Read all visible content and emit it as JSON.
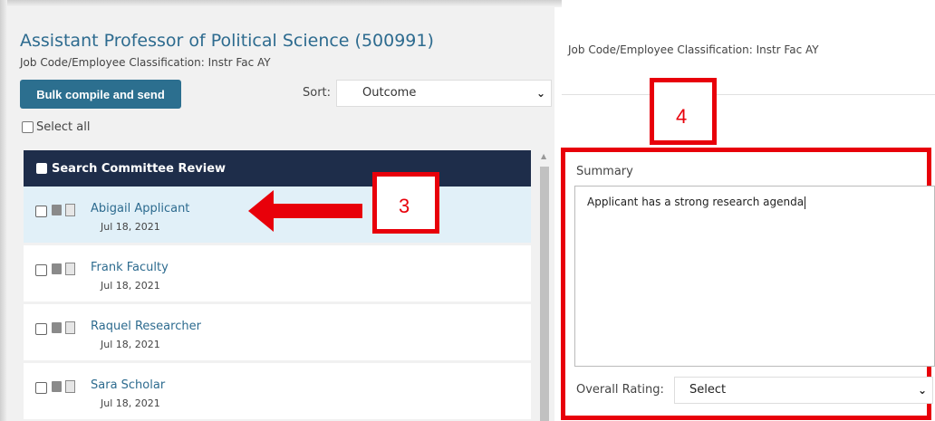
{
  "posting": {
    "title": "Assistant Professor of Political Science (500991)",
    "job_code_line": "Job Code/Employee Classification: Instr Fac AY"
  },
  "toolbar": {
    "bulk_label": "Bulk compile and send",
    "sort_label": "Sort:",
    "sort_value": "Outcome",
    "select_all_label": "Select all"
  },
  "list": {
    "header_label": "Search Committee Review",
    "applicants": [
      {
        "name": "Abigail Applicant",
        "date": "Jul 18, 2021"
      },
      {
        "name": "Frank Faculty",
        "date": "Jul 18, 2021"
      },
      {
        "name": "Raquel Researcher",
        "date": "Jul 18, 2021"
      },
      {
        "name": "Sara Scholar",
        "date": "Jul 18, 2021"
      }
    ]
  },
  "detail": {
    "job_code_line": "Job Code/Employee Classification:  Instr Fac AY",
    "summary_label": "Summary",
    "summary_text": "Applicant has a strong research agenda",
    "rating_label": "Overall Rating:",
    "rating_value": "Select"
  },
  "callouts": {
    "three": "3",
    "four": "4"
  },
  "colors": {
    "accent": "#2c6f8f",
    "header_bg": "#1e2d4a",
    "selected_row": "#e1f0f8",
    "callout_red": "#e8000a"
  },
  "icons": [
    "chevron-down-icon",
    "document-icon",
    "copy-icon",
    "arrow-left-icon",
    "scroll-up-icon"
  ]
}
